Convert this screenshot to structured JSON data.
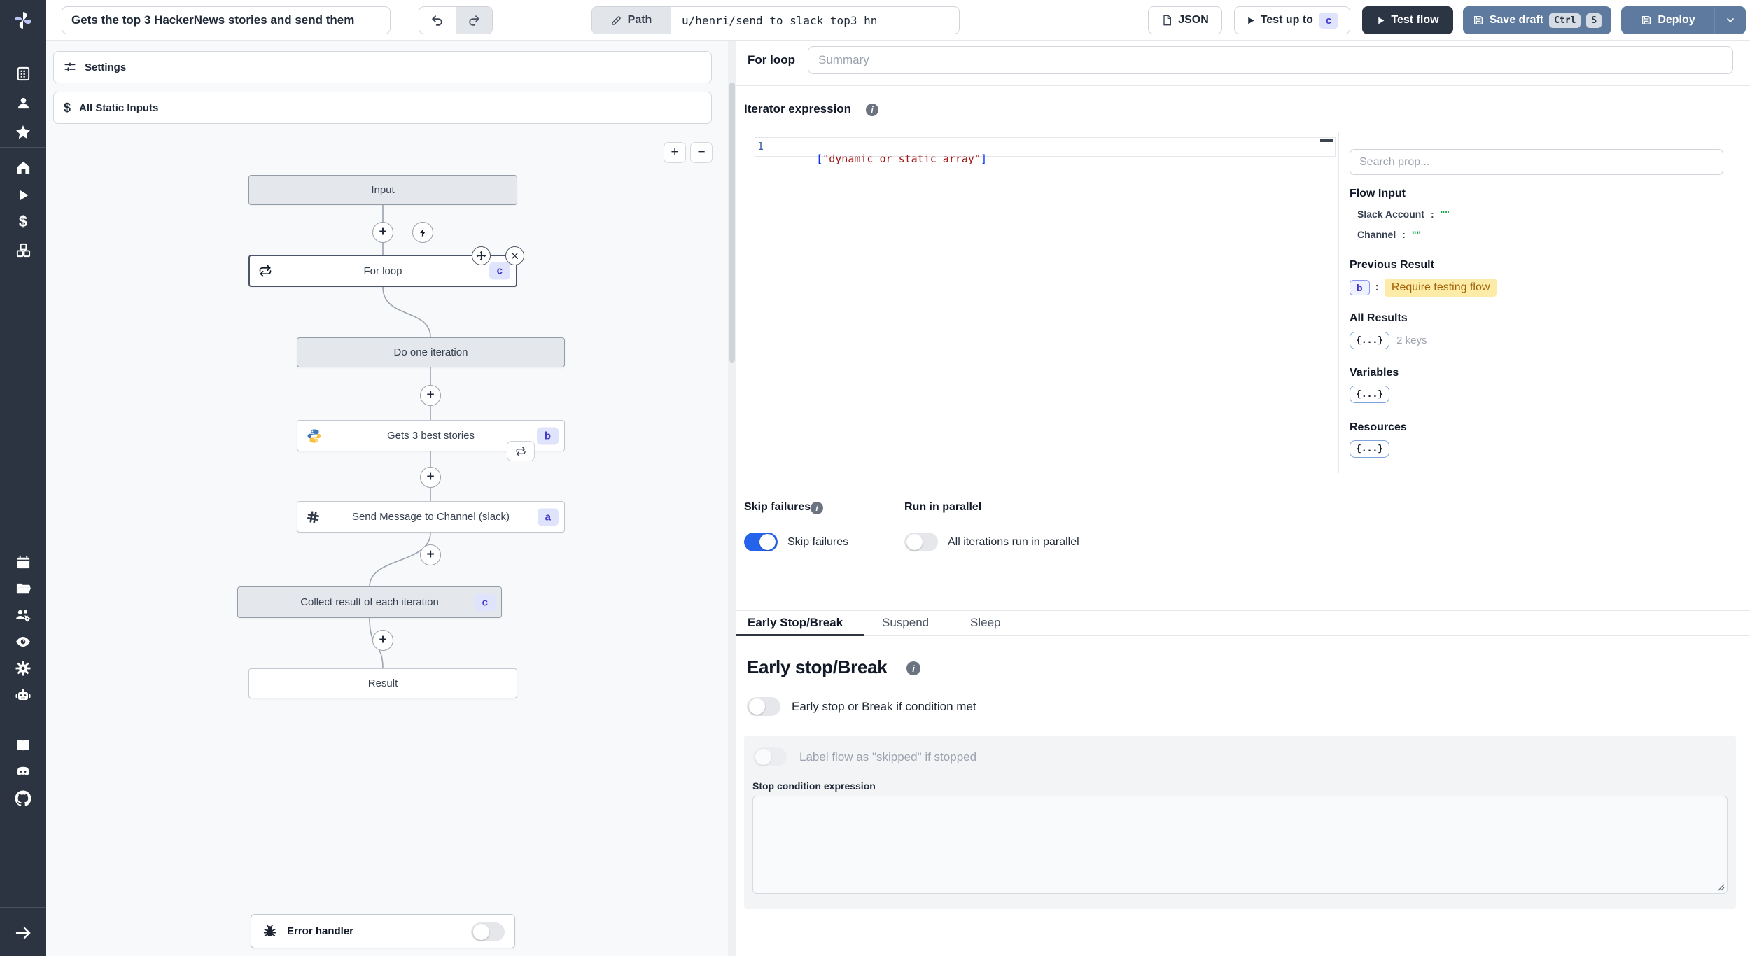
{
  "topbar": {
    "title_value": "Gets the top 3 HackerNews stories and send them",
    "path_label": "Path",
    "path_value": "u/henri/send_to_slack_top3_hn",
    "json_button": "JSON",
    "test_up_to_label": "Test up to",
    "test_up_to_badge": "c",
    "test_flow_label": "Test flow",
    "save_draft_label": "Save draft",
    "kbd_ctrl": "Ctrl",
    "kbd_s": "S",
    "deploy_label": "Deploy"
  },
  "sidebar": {
    "icons": [
      "windmill-logo",
      "workspace",
      "user",
      "favorites",
      "home",
      "runs",
      "variables",
      "resources",
      "schedules",
      "folders",
      "groups",
      "audit-logs",
      "workers",
      "ai",
      "docs",
      "discord",
      "github",
      "expand"
    ]
  },
  "flow": {
    "settings_label": "Settings",
    "static_inputs_label": "All Static Inputs",
    "nodes": [
      {
        "label": "Input"
      },
      {
        "label": "For loop",
        "badge": "c"
      },
      {
        "label": "Do one iteration"
      },
      {
        "label": "Gets 3 best stories",
        "badge": "b"
      },
      {
        "label": "Send Message to Channel (slack)",
        "badge": "a"
      },
      {
        "label": "Collect result of each iteration",
        "badge": "c"
      },
      {
        "label": "Result"
      }
    ],
    "error_handler_label": "Error handler"
  },
  "inspector": {
    "step_title": "For loop",
    "summary_placeholder": "Summary",
    "iterator_label": "Iterator expression",
    "editor": {
      "line_number": "1",
      "bracket_open": "[",
      "string": "\"dynamic or static array\"",
      "bracket_close": "]"
    },
    "props": {
      "search_placeholder": "Search prop...",
      "flow_input_title": "Flow Input",
      "rows": [
        {
          "key": "Slack Account",
          "sep": ":",
          "value": "\"\""
        },
        {
          "key": "Channel",
          "sep": ":",
          "value": "\"\""
        }
      ],
      "previous_result_title": "Previous Result",
      "previous_result_badge": "b",
      "previous_result_sep": ":",
      "previous_result_note": "Require testing flow",
      "all_results_title": "All Results",
      "all_results_meta": "2 keys",
      "variables_title": "Variables",
      "resources_title": "Resources",
      "object_token": "{...}"
    },
    "skip_failures_title": "Skip failures",
    "skip_failures_toggle": "Skip failures",
    "run_in_parallel_title": "Run in parallel",
    "run_in_parallel_toggle": "All iterations run in parallel",
    "tabs": [
      {
        "label": "Early Stop/Break"
      },
      {
        "label": "Suspend"
      },
      {
        "label": "Sleep"
      }
    ],
    "early_stop": {
      "title": "Early stop/Break",
      "toggle_label": "Early stop or Break if condition met",
      "skipped_toggle_label": "Label flow as \"skipped\" if stopped",
      "expression_label": "Stop condition expression"
    }
  },
  "colors": {
    "accent_blue": "#2563eb",
    "rail_bg": "#2b3440",
    "deploy_blue": "#5e7a9e",
    "dark_button": "#2b3544",
    "badge_bg": "#e0e3fc",
    "badge_text": "#4338ca",
    "amber_bg": "#fdeca8",
    "amber_text": "#a16207",
    "string_red": "#a31515",
    "bracket_blue": "#0431fa",
    "empty_string_green": "#16a34a"
  }
}
